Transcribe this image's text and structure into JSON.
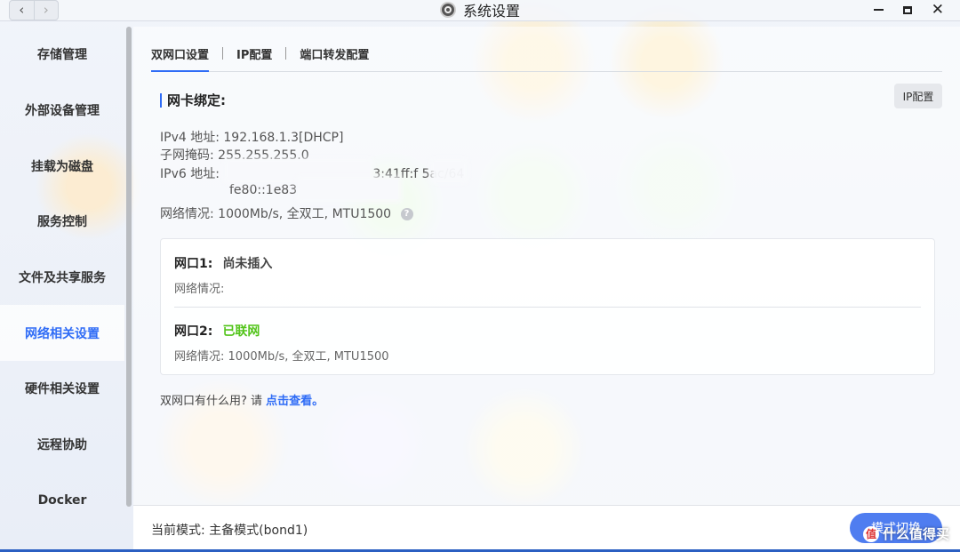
{
  "window": {
    "title": "系统设置",
    "back_glyph": "‹",
    "forward_glyph": "›",
    "close_glyph": "✕"
  },
  "sidebar": {
    "items": [
      {
        "label": "存储管理"
      },
      {
        "label": "外部设备管理"
      },
      {
        "label": "挂载为磁盘"
      },
      {
        "label": "服务控制"
      },
      {
        "label": "文件及共享服务"
      },
      {
        "label": "网络相关设置",
        "active": true
      },
      {
        "label": "硬件相关设置"
      },
      {
        "label": "远程协助"
      },
      {
        "label": "Docker"
      }
    ]
  },
  "tabs": [
    {
      "label": "双网口设置",
      "active": true
    },
    {
      "label": "IP配置"
    },
    {
      "label": "端口转发配置"
    }
  ],
  "section": {
    "title": "网卡绑定:",
    "ip_config_button": "IP配置"
  },
  "info": {
    "ipv4_label": "IPv4 地址:",
    "ipv4_value": "192.168.1.3[DHCP]",
    "mask_label": "子网掩码:",
    "mask_value": "255.255.255.0",
    "ipv6_label": "IPv6 地址:",
    "ipv6_value_1": "3:41ff:f      5ac/64",
    "ipv6_value_2": "fe80::1e83",
    "net_label": "网络情况:",
    "net_value": "1000Mb/s, 全双工, MTU1500",
    "help_glyph": "?"
  },
  "ports": [
    {
      "name": "网口1:",
      "status": "尚未插入",
      "detail_label": "网络情况:",
      "detail_value": ""
    },
    {
      "name": "网口2:",
      "status": "已联网",
      "detail_label": "网络情况:",
      "detail_value": "1000Mb/s, 全双工, MTU1500"
    }
  ],
  "help": {
    "text": "双网口有什么用? 请 ",
    "link": "点击查看。"
  },
  "footer": {
    "mode": "当前模式: 主备模式(bond1)",
    "switch_button": "模式切换"
  },
  "watermark": {
    "icon": "值",
    "text": "什么值得买"
  },
  "colors": {
    "accent": "#2f6cf6",
    "online": "#52c41a"
  }
}
